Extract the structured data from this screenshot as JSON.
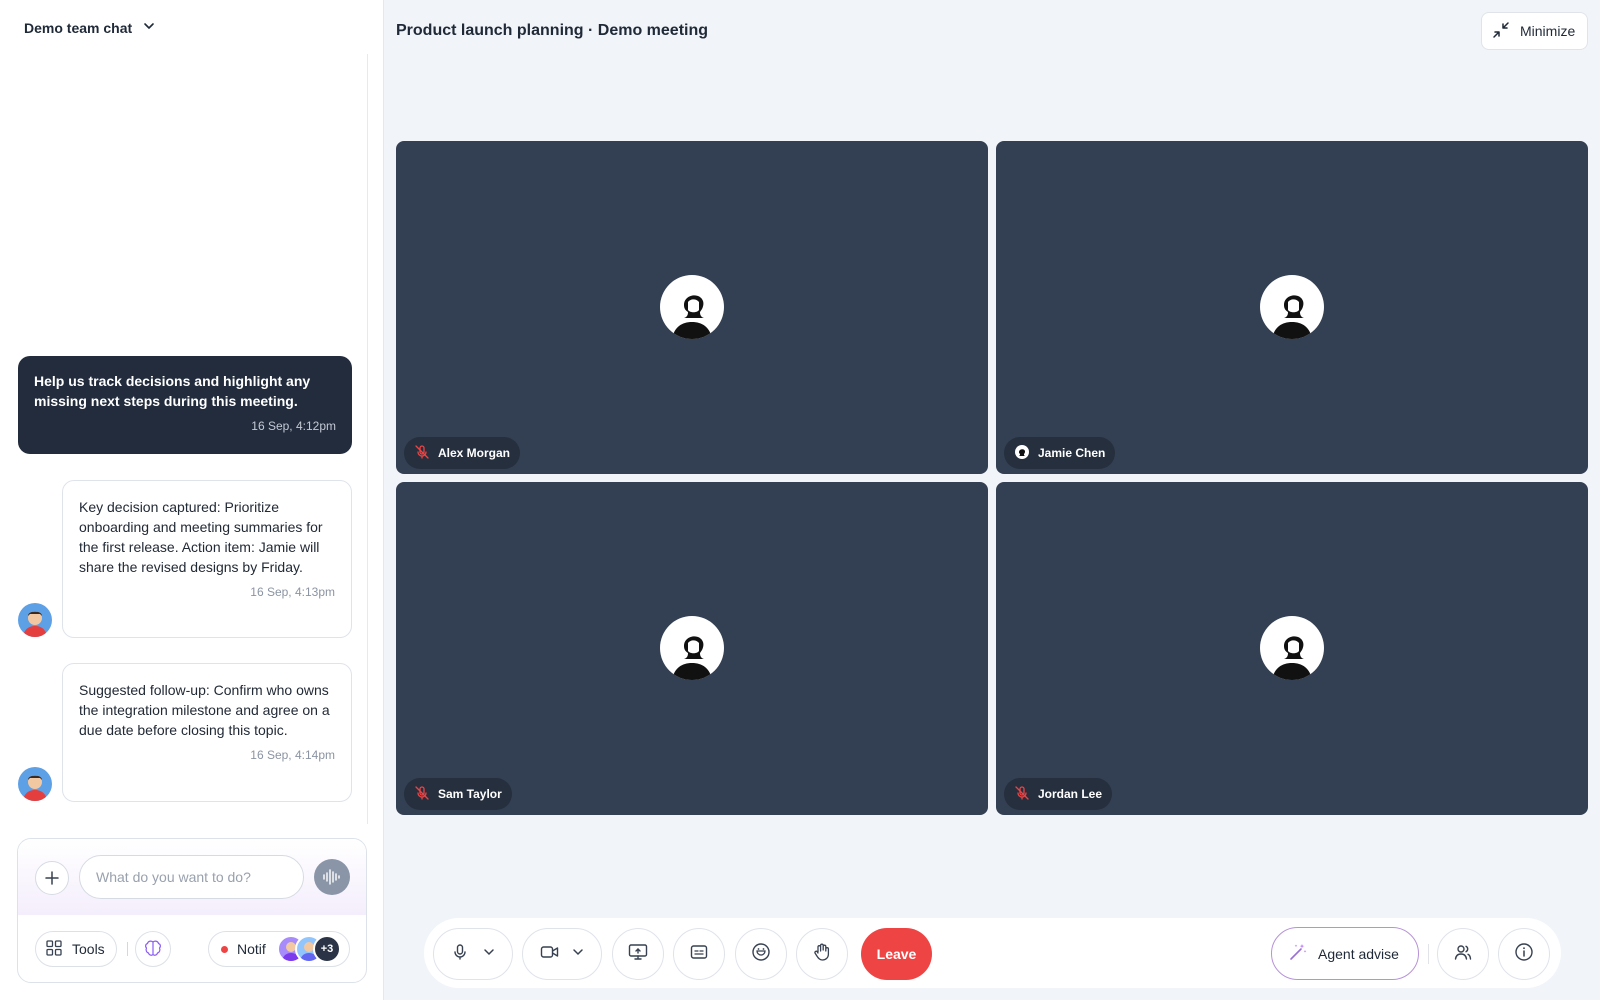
{
  "sidebar": {
    "title": "Demo team chat",
    "messages": [
      {
        "role": "user",
        "text": "Help us track decisions and highlight any missing next steps during this meeting.",
        "time": "16 Sep, 4:12pm"
      },
      {
        "role": "agent",
        "text": "Key decision captured: Prioritize onboarding and meeting summaries for the first release. Action item: Jamie will share the revised designs by Friday.",
        "time": "16 Sep, 4:13pm"
      },
      {
        "role": "agent",
        "text": "Suggested follow-up: Confirm who owns the integration milestone and agree on a due date before closing this topic.",
        "time": "16 Sep, 4:14pm"
      }
    ],
    "composer": {
      "placeholder": "What do you want to do?",
      "tools_label": "Tools",
      "notif_label": "Notif",
      "more_count": "+3"
    }
  },
  "meeting": {
    "title": "Product launch planning · Demo meeting",
    "minimize_label": "Minimize",
    "participants": [
      {
        "name": "Alex Morgan",
        "status_icon": "mic-off-icon"
      },
      {
        "name": "Jamie Chen",
        "status_icon": "speaking-icon"
      },
      {
        "name": "Sam Taylor",
        "status_icon": "mic-off-icon"
      },
      {
        "name": "Jordan Lee",
        "status_icon": "mic-off-icon"
      }
    ]
  },
  "controls": {
    "leave_label": "Leave",
    "agent_label": "Agent advise"
  },
  "colors": {
    "tile_bg": "#333f52",
    "leave": "#ef4444",
    "user_bubble": "#222c3c",
    "agent_border": "#b792d9"
  }
}
